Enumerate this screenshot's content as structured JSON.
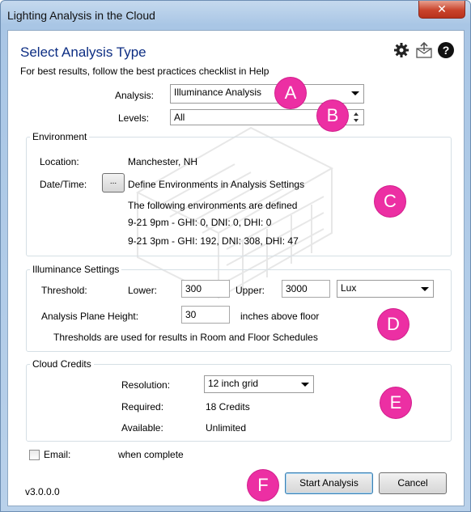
{
  "window": {
    "title": "Lighting Analysis in the Cloud",
    "close_glyph": "✕"
  },
  "header": {
    "title": "Select Analysis Type",
    "subtitle": "For best results, follow the best practices checklist in Help",
    "icons": [
      "gear-icon",
      "export-icon",
      "help-icon"
    ]
  },
  "analysis": {
    "label": "Analysis:",
    "value": "Illuminance Analysis"
  },
  "levels": {
    "label": "Levels:",
    "value": "All"
  },
  "environment": {
    "title": "Environment",
    "location_label": "Location:",
    "location_value": "Manchester, NH",
    "datetime_label": "Date/Time:",
    "browse_label": "...",
    "define_text": "Define Environments in Analysis Settings",
    "defined_header": "The following environments are defined",
    "env_lines": [
      "9-21 9pm - GHI: 0, DNI: 0, DHI: 0",
      "9-21 3pm - GHI: 192, DNI: 308, DHI: 47"
    ]
  },
  "illuminance": {
    "title": "Illuminance Settings",
    "threshold_label": "Threshold:",
    "lower_label": "Lower:",
    "lower_value": "300",
    "upper_label": "Upper:",
    "upper_value": "3000",
    "unit_value": "Lux",
    "plane_label": "Analysis Plane Height:",
    "plane_value": "30",
    "plane_unit": "inches above floor",
    "note": "Thresholds are used for results in Room and Floor Schedules"
  },
  "credits": {
    "title": "Cloud Credits",
    "resolution_label": "Resolution:",
    "resolution_value": "12 inch grid",
    "required_label": "Required:",
    "required_value": "18 Credits",
    "available_label": "Available:",
    "available_value": "Unlimited"
  },
  "email": {
    "label": "Email:",
    "suffix": "when complete",
    "checked": false
  },
  "footer": {
    "version": "v3.0.0.0",
    "start_label": "Start Analysis",
    "cancel_label": "Cancel"
  },
  "callouts": [
    "A",
    "B",
    "C",
    "D",
    "E",
    "F"
  ],
  "colors": {
    "title_blue": "#0c2d83",
    "callout_magenta": "#ec2fa3"
  }
}
